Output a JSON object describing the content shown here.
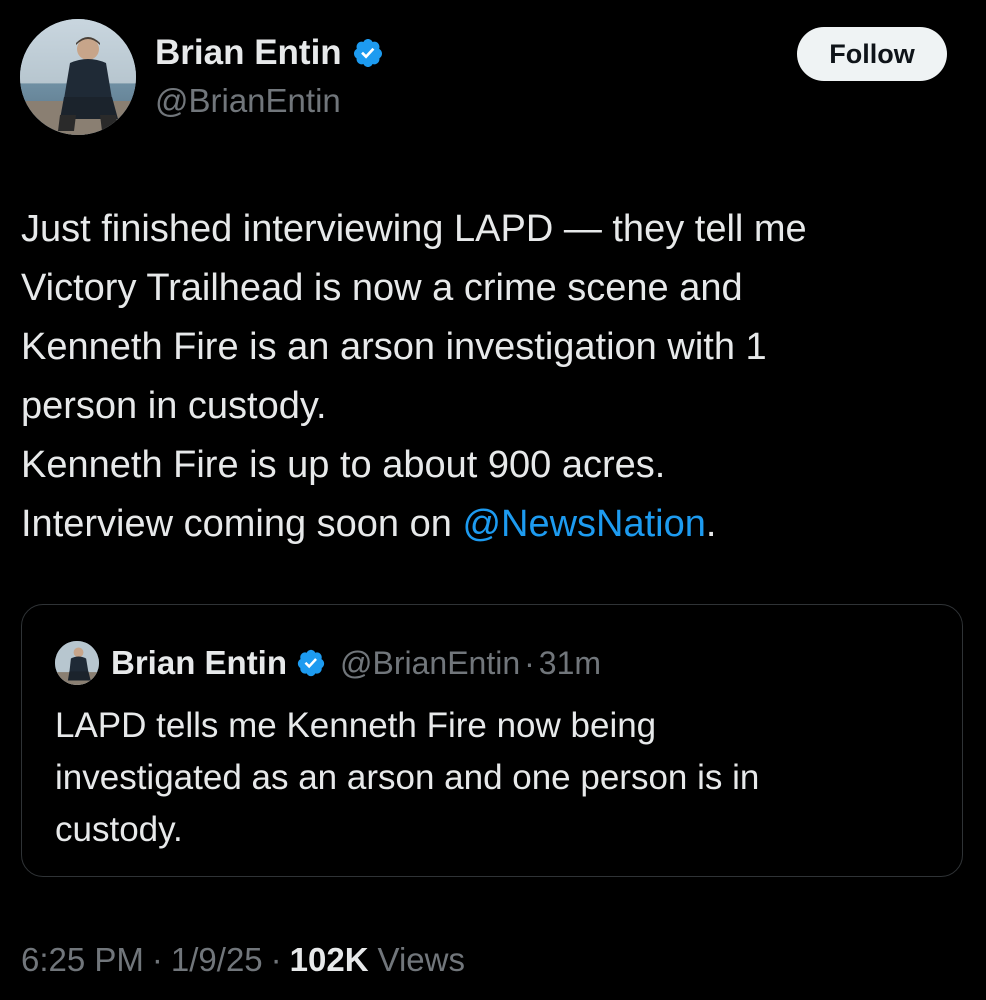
{
  "author": {
    "display_name": "Brian Entin",
    "handle": "@BrianEntin",
    "verified": true,
    "avatar": "profile-photo"
  },
  "follow_button": {
    "label": "Follow"
  },
  "tweet": {
    "lines": [
      "Just finished interviewing LAPD — they tell me",
      "Victory Trailhead is now a crime scene and",
      "Kenneth Fire is an arson investigation with 1",
      "person in custody.",
      "Kenneth Fire is up to about 900 acres."
    ],
    "last_line_prefix": "Interview coming soon on ",
    "mention": "@NewsNation",
    "last_line_suffix": "."
  },
  "quoted_tweet": {
    "display_name": "Brian Entin",
    "handle": "@BrianEntin",
    "separator": "·",
    "time": "31m",
    "lines": [
      "LAPD tells me Kenneth Fire now being",
      "investigated as an arson and one person is in",
      "custody."
    ]
  },
  "meta": {
    "time": "6:25 PM",
    "date": "1/9/25",
    "separator": "·",
    "views_count": "102K",
    "views_label": "Views"
  },
  "colors": {
    "background": "#000000",
    "text": "#e7e9ea",
    "secondary": "#71767b",
    "link": "#1d9bf0",
    "verified": "#1d9bf0",
    "border": "#2f3336",
    "follow_bg": "#eff3f4"
  }
}
